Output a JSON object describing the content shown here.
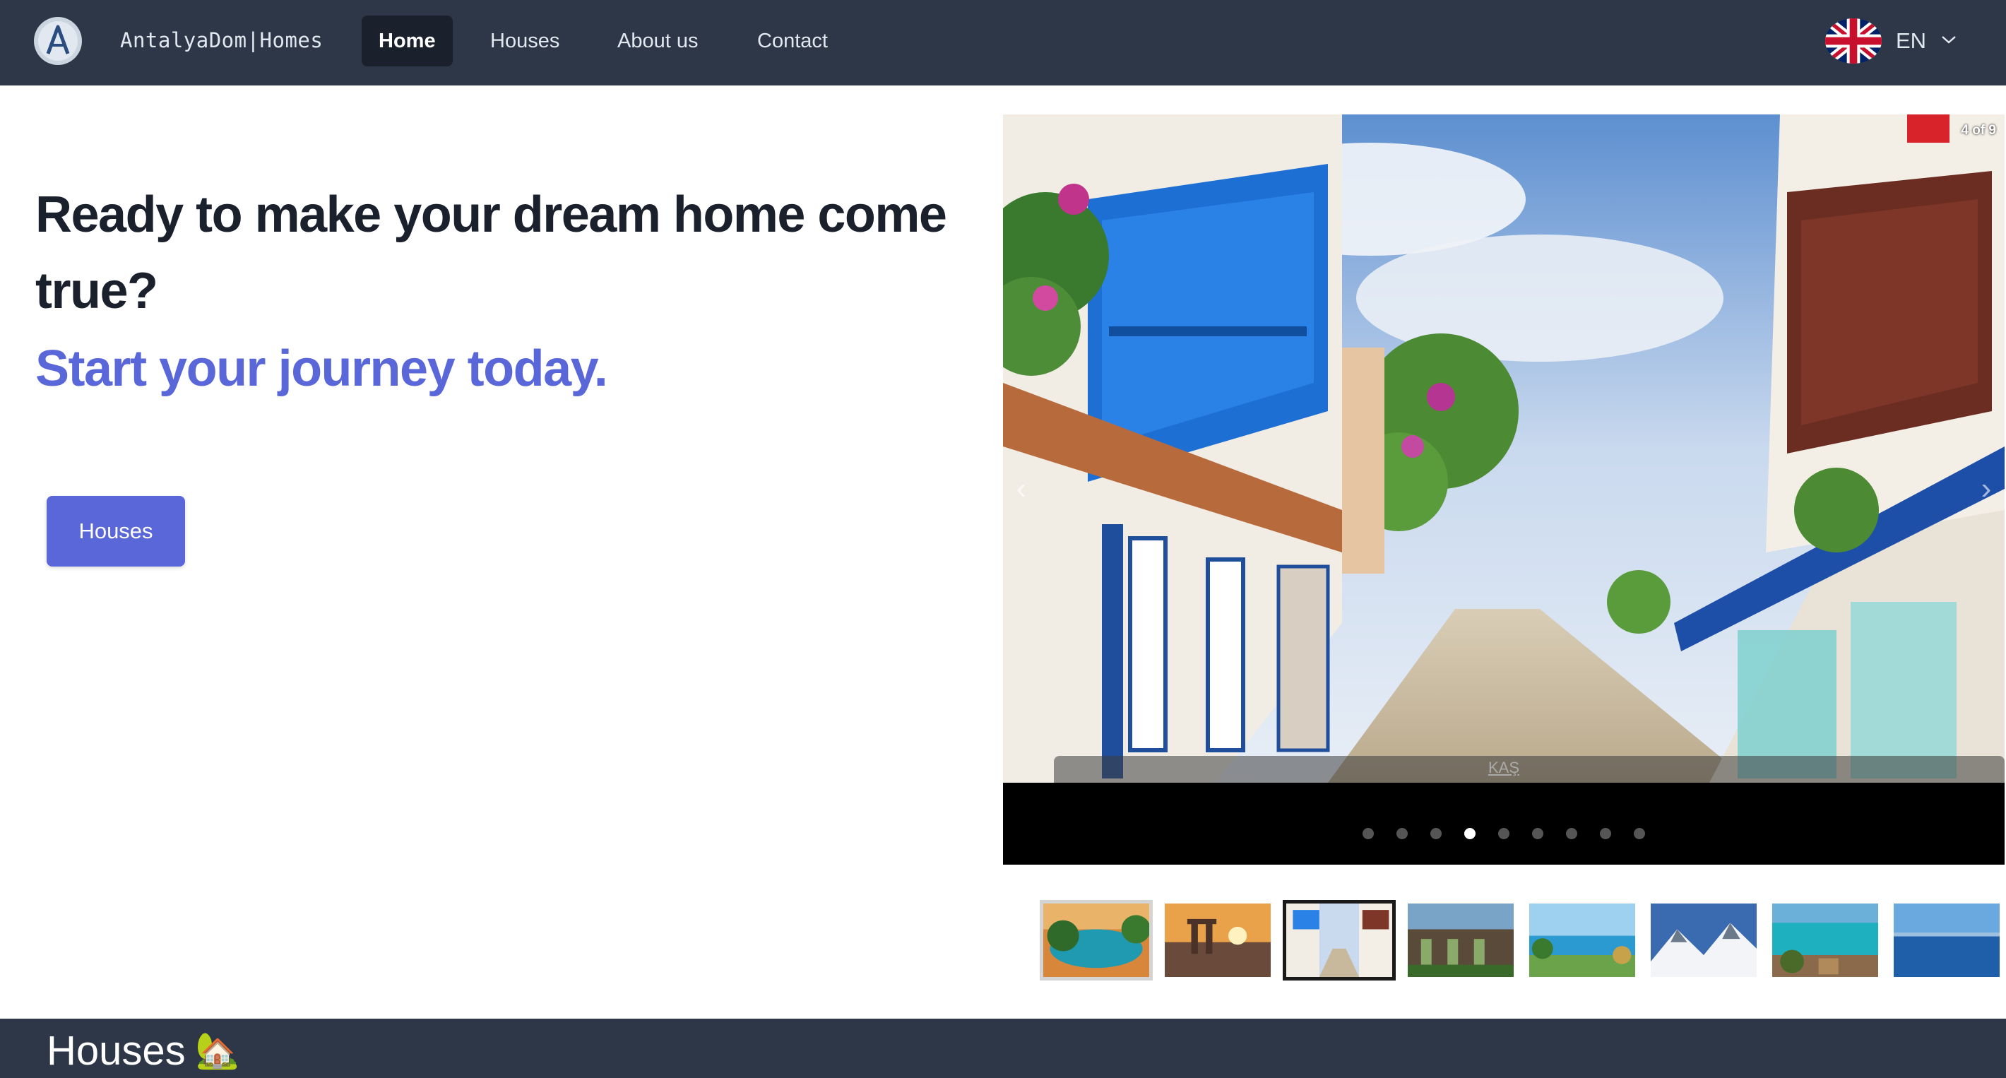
{
  "nav": {
    "brand": "AntalyaDom|Homes",
    "links": [
      {
        "label": "Home",
        "active": true
      },
      {
        "label": "Houses",
        "active": false
      },
      {
        "label": "About us",
        "active": false
      },
      {
        "label": "Contact",
        "active": false
      }
    ],
    "language": {
      "code": "EN",
      "flag_icon": "uk-flag-icon"
    }
  },
  "hero": {
    "title": "Ready to make your dream home come true?",
    "subtitle": "Start your journey today.",
    "button_label": "Houses"
  },
  "carousel": {
    "counter": "4 of 9",
    "caption": "KAŞ",
    "total_slides": 9,
    "active_index": 3
  },
  "thumbnails": [
    {
      "name": "lagoon"
    },
    {
      "name": "ruins-sunset"
    },
    {
      "name": "kas-street"
    },
    {
      "name": "aqueduct"
    },
    {
      "name": "coast-palms"
    },
    {
      "name": "snow-mountains"
    },
    {
      "name": "turquoise-bay"
    },
    {
      "name": "sea-horizon"
    }
  ],
  "section": {
    "title": "Houses",
    "icon": "🏡"
  },
  "colors": {
    "navbar": "#2d3748",
    "accent": "#5a67d8",
    "heading": "#1a202c"
  }
}
